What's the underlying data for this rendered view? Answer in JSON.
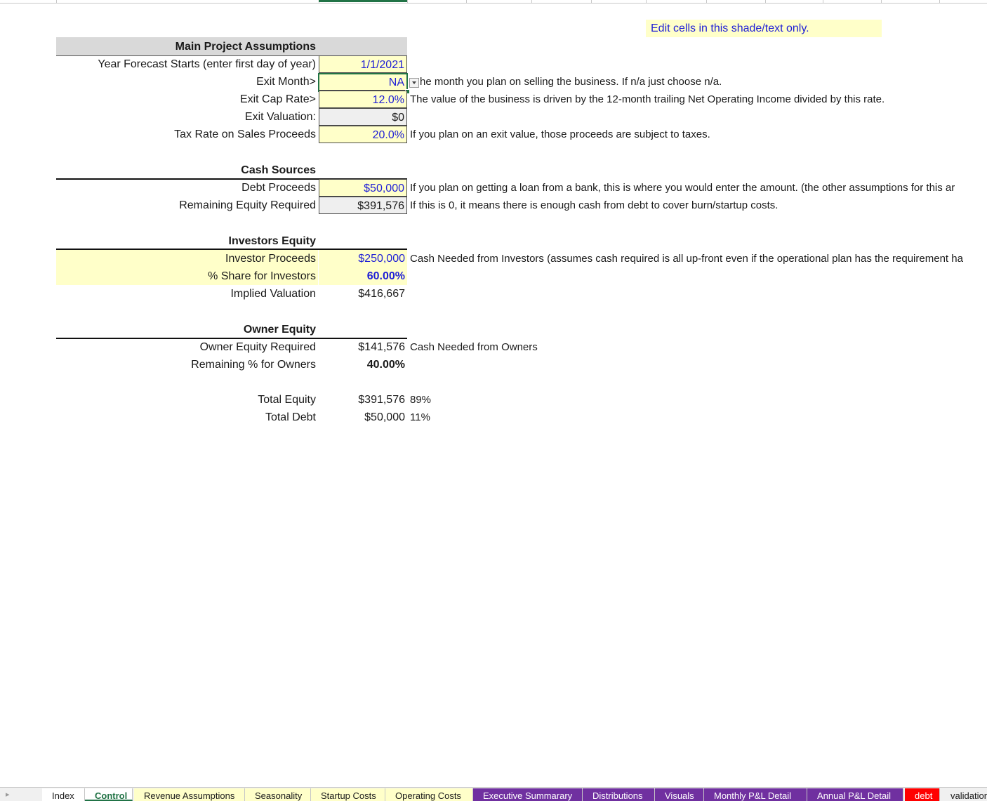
{
  "note": "Edit cells in this shade/text only.",
  "main": {
    "header": "Main Project Assumptions",
    "rows": [
      {
        "label": "Year Forecast Starts (enter first day of year)",
        "value": "1/1/2021",
        "desc": ""
      },
      {
        "label": "Exit Month>",
        "value": "NA",
        "desc": "he month you plan on selling the business. If n/a just choose n/a."
      },
      {
        "label": "Exit Cap Rate>",
        "value": "12.0%",
        "desc": "The value of the business is driven by the 12-month trailing Net Operating Income divided by this rate."
      },
      {
        "label": "Exit Valuation:",
        "value": "$0",
        "desc": ""
      },
      {
        "label": "Tax Rate on Sales Proceeds",
        "value": "20.0%",
        "desc": "If you plan on an exit value, those proceeds are subject to taxes."
      }
    ]
  },
  "cash": {
    "header": "Cash Sources",
    "rows": [
      {
        "label": "Debt Proceeds",
        "value": "$50,000",
        "desc": "If you plan on getting a loan from a bank, this is where you would enter the amount. (the other assumptions for this ar"
      },
      {
        "label": "Remaining Equity Required",
        "value": "$391,576",
        "desc": "If this is 0, it means there is enough cash from debt to cover burn/startup costs."
      }
    ]
  },
  "investors": {
    "header": "Investors Equity",
    "rows": [
      {
        "label": "Investor Proceeds",
        "value": "$250,000",
        "desc": "Cash Needed from Investors (assumes cash required is all up-front even if the operational plan has the requirement ha"
      },
      {
        "label": "% Share for Investors",
        "value": "60.00%",
        "desc": ""
      },
      {
        "label": "Implied Valuation",
        "value": "$416,667",
        "desc": ""
      }
    ]
  },
  "owner": {
    "header": "Owner Equity",
    "rows": [
      {
        "label": "Owner Equity Required",
        "value": "$141,576",
        "desc": "Cash Needed from Owners"
      },
      {
        "label": "Remaining % for Owners",
        "value": "40.00%",
        "desc": ""
      }
    ]
  },
  "totals": {
    "rows": [
      {
        "label": "Total Equity",
        "value": "$391,576",
        "pct": "89%"
      },
      {
        "label": "Total Debt",
        "value": "$50,000",
        "pct": "11%"
      }
    ]
  },
  "tabs": [
    {
      "label": "Index",
      "bg": "#ffffff",
      "color": "#1a1a1a"
    },
    {
      "label": "Control",
      "bg": "#ffffff",
      "color": "#217346",
      "active": true
    },
    {
      "label": "Revenue Assumptions",
      "bg": "#ffffc9",
      "color": "#1a1a1a"
    },
    {
      "label": "Seasonality",
      "bg": "#ffffc9",
      "color": "#1a1a1a"
    },
    {
      "label": "Startup Costs",
      "bg": "#ffffc9",
      "color": "#1a1a1a"
    },
    {
      "label": "Operating Costs",
      "bg": "#ffffc9",
      "color": "#1a1a1a"
    },
    {
      "label": "Executive Summarary",
      "bg": "#7030a0",
      "color": "#ffffff"
    },
    {
      "label": "Distributions",
      "bg": "#7030a0",
      "color": "#ffffff"
    },
    {
      "label": "Visuals",
      "bg": "#7030a0",
      "color": "#ffffff"
    },
    {
      "label": "Monthly P&L Detail",
      "bg": "#7030a0",
      "color": "#ffffff"
    },
    {
      "label": "Annual P&L Detail",
      "bg": "#7030a0",
      "color": "#ffffff"
    },
    {
      "label": "debt",
      "bg": "#ff0000",
      "color": "#ffffff"
    },
    {
      "label": "validation",
      "bg": "#f0f0f0",
      "color": "#1a1a1a"
    }
  ]
}
